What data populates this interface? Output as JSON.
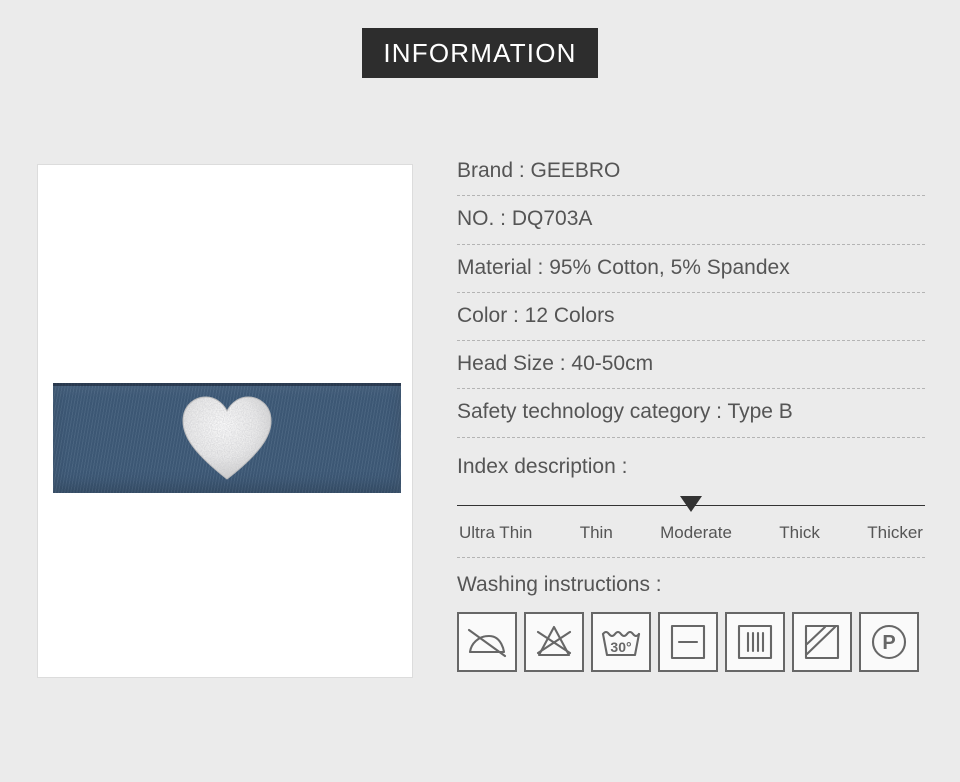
{
  "header": {
    "title": "INFORMATION"
  },
  "product_image": {
    "alt_name": "navy-blue-headband-with-silver-glitter-heart",
    "band_color": "#3f5b79",
    "heart_color": "#e9e9e9",
    "frame_background": "#ffffff"
  },
  "page": {
    "background_color": "#ebebeb",
    "text_color": "#555555",
    "accent_color": "#2d2d2d"
  },
  "specs": [
    {
      "label": "Brand",
      "value": "GEEBRO",
      "text": "Brand : GEEBRO"
    },
    {
      "label": "NO.",
      "value": "DQ703A",
      "text": "NO. : DQ703A"
    },
    {
      "label": "Material",
      "value": "95% Cotton, 5% Spandex",
      "text": "Material : 95% Cotton, 5% Spandex"
    },
    {
      "label": "Color",
      "value": "12 Colors",
      "text": "Color : 12 Colors"
    },
    {
      "label": "Head Size",
      "value": "40-50cm",
      "text": "Head Size : 40-50cm"
    },
    {
      "label": "Safety technology category",
      "value": "Type B",
      "text": "Safety technology category : Type B"
    }
  ],
  "index_description": {
    "title": "Index description :",
    "levels": [
      "Ultra Thin",
      "Thin",
      "Moderate",
      "Thick",
      "Thicker"
    ],
    "selected": "Moderate",
    "selected_index": 2,
    "marker_position_percent": 50
  },
  "washing_instructions": {
    "title": "Washing instructions :",
    "symbols": [
      {
        "name": "do-not-iron-icon",
        "label": "Do not iron"
      },
      {
        "name": "do-not-bleach-icon",
        "label": "Do not bleach"
      },
      {
        "name": "machine-wash-30-icon",
        "label": "Machine wash at 30°",
        "temperature": "30°"
      },
      {
        "name": "dry-flat-icon",
        "label": "Dry flat"
      },
      {
        "name": "drip-dry-icon",
        "label": "Drip dry"
      },
      {
        "name": "dry-in-shade-icon",
        "label": "Dry in shade"
      },
      {
        "name": "dry-clean-petroleum-icon",
        "label": "Dry clean with petroleum solvent",
        "letter": "P"
      }
    ]
  }
}
